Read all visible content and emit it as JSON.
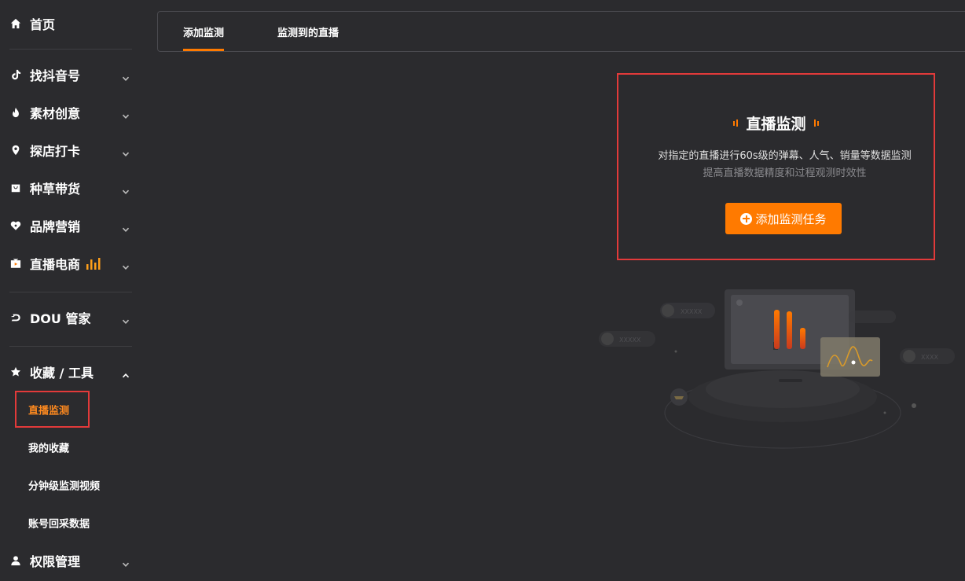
{
  "sidebar": {
    "home": "首页",
    "items": [
      {
        "label": "找抖音号",
        "icon": "tiktok-icon"
      },
      {
        "label": "素材创意",
        "icon": "flame-icon"
      },
      {
        "label": "探店打卡",
        "icon": "location-pin-icon"
      },
      {
        "label": "种草带货",
        "icon": "bag-icon"
      },
      {
        "label": "品牌营销",
        "icon": "heart-icon"
      },
      {
        "label": "直播电商",
        "icon": "live-tv-icon"
      }
    ],
    "dou": "DOU 管家",
    "favorites": "收藏 / 工具",
    "sub_items": [
      {
        "label": "直播监测",
        "active": true
      },
      {
        "label": "我的收藏"
      },
      {
        "label": "分钟级监测视频"
      },
      {
        "label": "账号回采数据"
      }
    ],
    "permissions": "权限管理"
  },
  "tabs": [
    {
      "label": "添加监测",
      "active": true
    },
    {
      "label": "监测到的直播"
    }
  ],
  "panel": {
    "title": "直播监测",
    "desc1": "对指定的直播进行60s级的弹幕、人气、销量等数据监测",
    "desc2": "提高直播数据精度和过程观测时效性",
    "button": "添加监测任务"
  },
  "illustration": {
    "placeholder_left": "XXXXX",
    "placeholder_top": "XXXXX",
    "placeholder_right": "XXXX"
  },
  "colors": {
    "accent": "#ff7a00",
    "highlight_border": "#e23a3a",
    "background": "#2b2b2e"
  }
}
